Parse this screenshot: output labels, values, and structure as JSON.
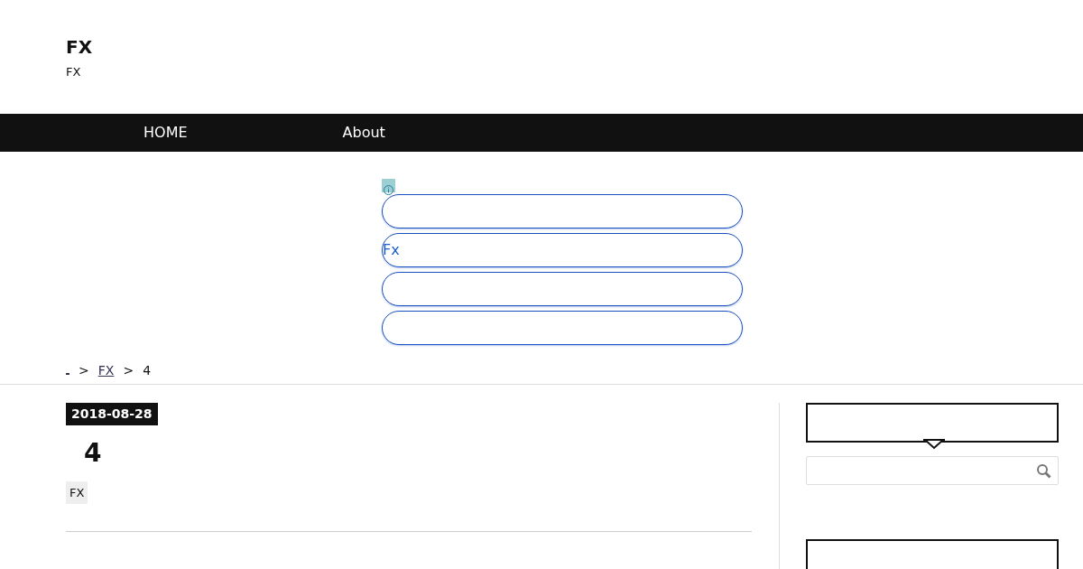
{
  "site": {
    "title": "FX",
    "tagline": "FX"
  },
  "nav": [
    {
      "label": "HOME"
    },
    {
      "label": "About"
    }
  ],
  "ad": {
    "buttons": [
      {
        "kind": "blank"
      },
      {
        "kind": "text",
        "label": "Fx"
      },
      {
        "kind": "blank"
      },
      {
        "kind": "blank"
      }
    ]
  },
  "breadcrumb_separator": ">",
  "breadcrumb": [
    {
      "kind": "home"
    },
    {
      "kind": "link",
      "label": "FX"
    },
    {
      "kind": "current",
      "label": "4"
    }
  ],
  "post": {
    "date": "2018-08-28",
    "title": "4",
    "tags": [
      "FX"
    ]
  },
  "sidebar": [
    {
      "kind": "pointer"
    },
    {
      "kind": "search"
    },
    {
      "kind": "plain"
    }
  ]
}
